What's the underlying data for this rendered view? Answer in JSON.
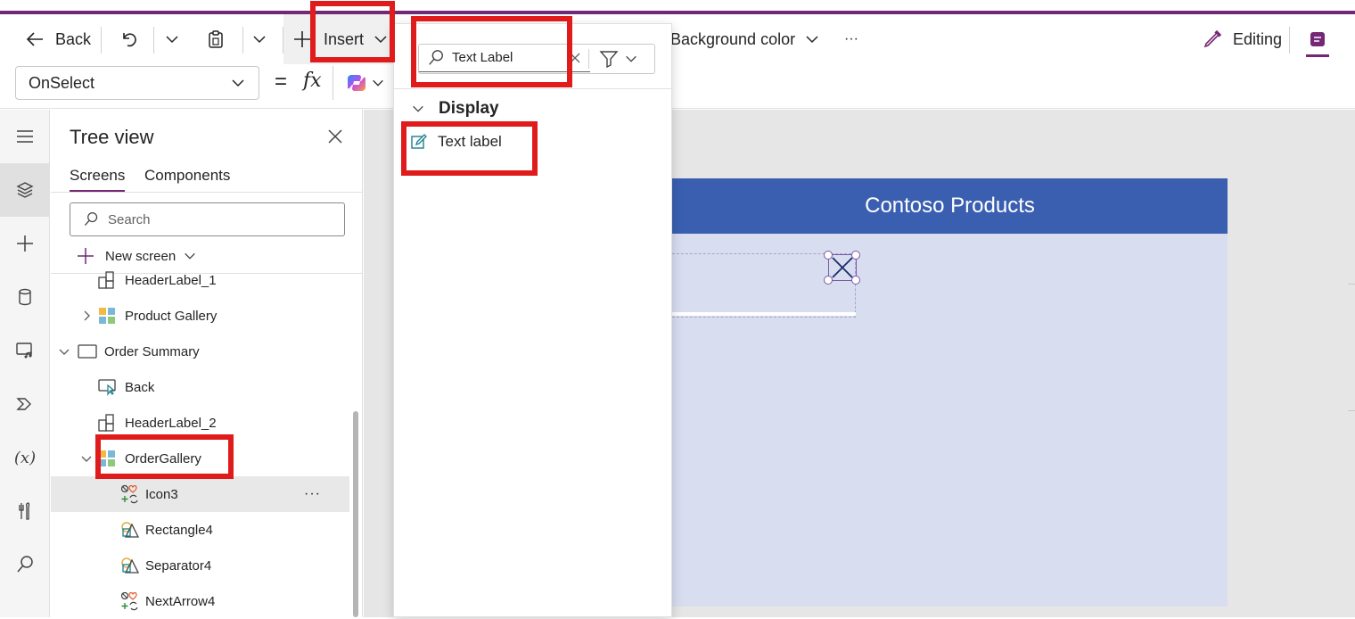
{
  "toolbar": {
    "back_label": "Back",
    "insert_label": "Insert",
    "background_color_label": "Background color",
    "more_label": "···",
    "editing_label": "Editing"
  },
  "formula_bar": {
    "property": "OnSelect",
    "equals": "=",
    "fx": "fx"
  },
  "insert_panel": {
    "search_value": "Text Label",
    "section_title": "Display",
    "items": [
      {
        "label": "Text label",
        "icon": "edit-icon"
      }
    ]
  },
  "tree_view": {
    "title": "Tree view",
    "tabs": [
      {
        "label": "Screens",
        "active": true
      },
      {
        "label": "Components",
        "active": false
      }
    ],
    "search_placeholder": "Search",
    "new_screen_label": "New screen",
    "rows": [
      {
        "label": "HeaderLabel_1",
        "icon": "label-icon"
      },
      {
        "label": "Product Gallery",
        "icon": "gallery-icon"
      },
      {
        "label": "Order Summary",
        "icon": "screen-icon"
      },
      {
        "label": "Back",
        "icon": "button-icon"
      },
      {
        "label": "HeaderLabel_2",
        "icon": "label-icon"
      },
      {
        "label": "OrderGallery",
        "icon": "gallery-icon"
      },
      {
        "label": "Icon3",
        "icon": "icons-icon"
      },
      {
        "label": "Rectangle4",
        "icon": "shape-icon"
      },
      {
        "label": "Separator4",
        "icon": "shape-icon"
      },
      {
        "label": "NextArrow4",
        "icon": "icons-icon"
      }
    ],
    "row_more": "···"
  },
  "canvas": {
    "header_text": "Contoso Products"
  },
  "colors": {
    "accent": "#742774",
    "header_blue": "#3a5fb0",
    "screen_bg": "#d8ddf0",
    "highlight_red": "#e01b1b"
  }
}
